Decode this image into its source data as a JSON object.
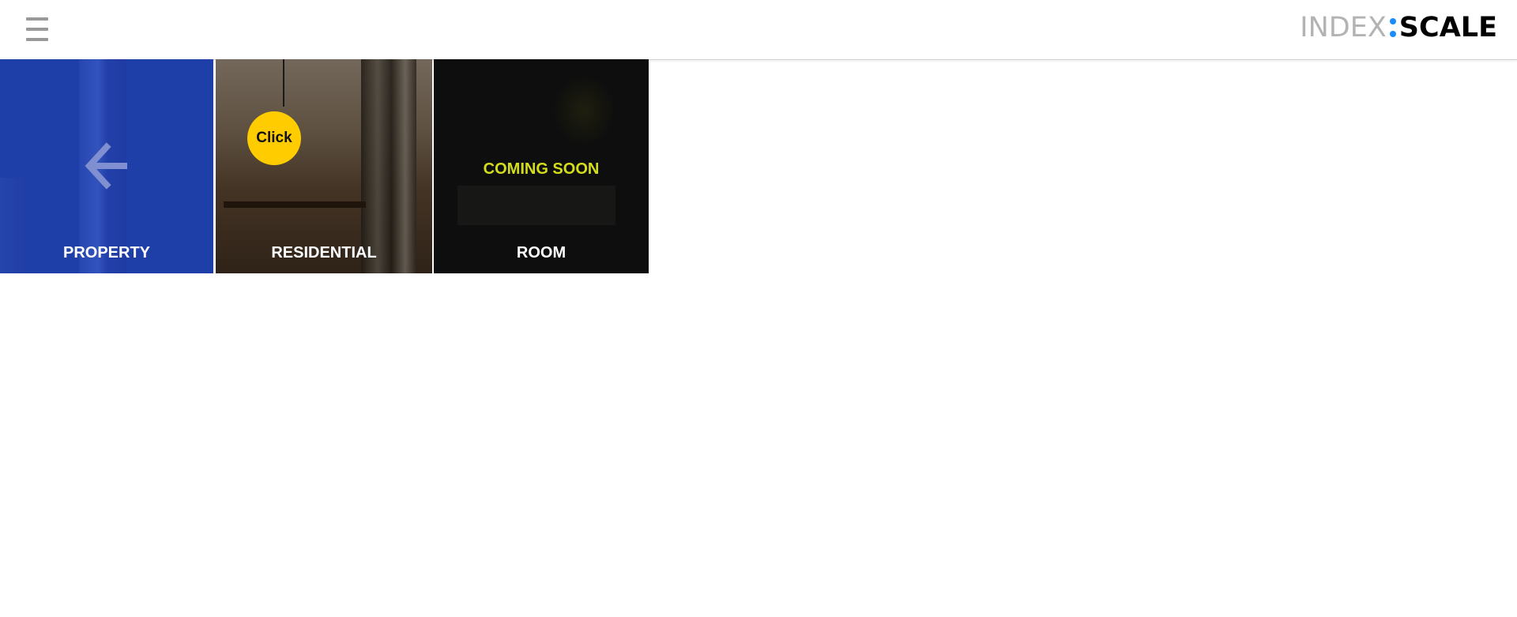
{
  "header": {
    "logo": {
      "part1": "INDEX",
      "part2": "SCALE",
      "accent_color": "#1a8cff"
    },
    "menu_icon": "hamburger-icon"
  },
  "tiles": [
    {
      "label": "PROPERTY",
      "icon": "arrow-left-icon",
      "color": "#1e3ea8"
    },
    {
      "label": "RESIDENTIAL",
      "badge": "Click",
      "badge_color": "#ffcc00"
    },
    {
      "label": "ROOM",
      "status": "COMING SOON",
      "status_color": "#d4dd1a"
    }
  ]
}
